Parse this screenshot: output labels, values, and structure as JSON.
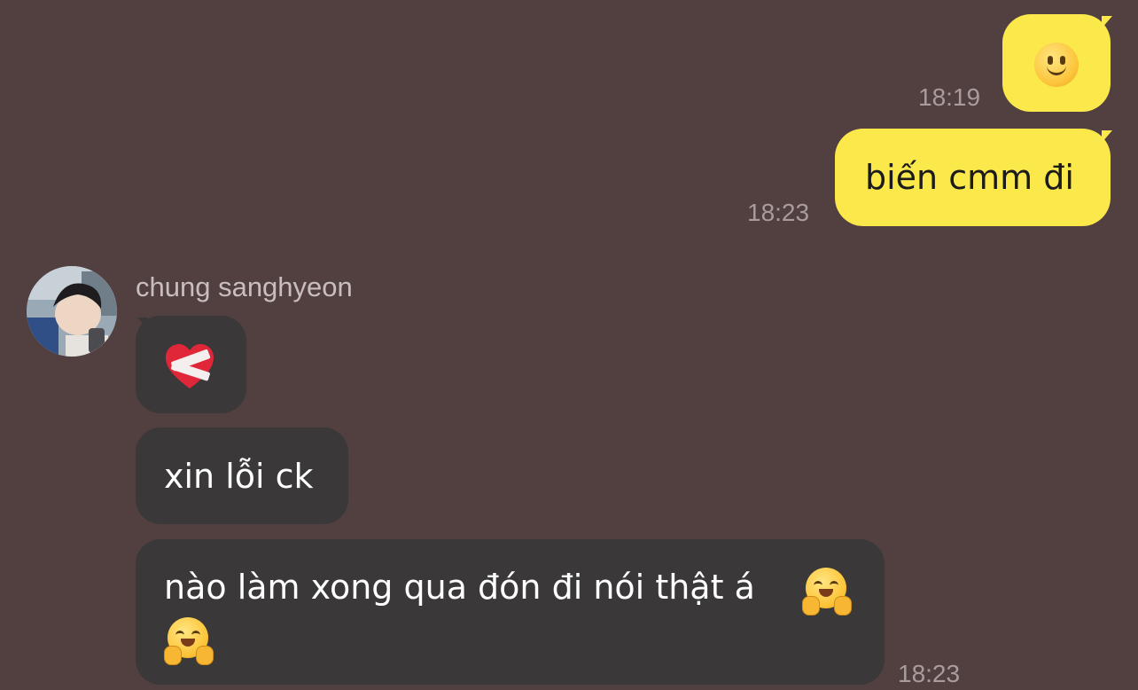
{
  "messages_out": [
    {
      "emoji": "slightly-smiling-face-icon",
      "time": "18:19"
    },
    {
      "text": "biến cmm đi",
      "time": "18:23"
    }
  ],
  "contact": {
    "name": "chung sanghyeon",
    "avatar_icon": "profile-photo"
  },
  "messages_in": [
    {
      "emoji": "mending-heart-icon"
    },
    {
      "text": "xin lỗi ck"
    },
    {
      "text": "nào làm xong qua đón đi nói thật á",
      "emojis": [
        "hugging-face-icon",
        "hugging-face-icon"
      ],
      "time": "18:23"
    }
  ],
  "colors": {
    "background": "#524040",
    "outgoing_bubble": "#fbe84b",
    "incoming_bubble": "#3a3838",
    "timestamp": "#a99c9c"
  }
}
